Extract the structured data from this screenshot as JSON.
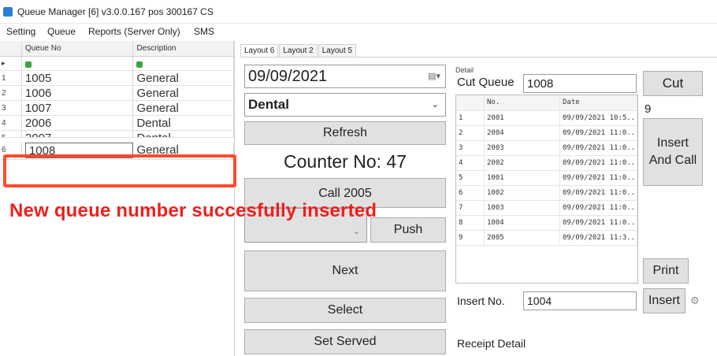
{
  "window": {
    "title": "Queue Manager [6] v3.0.0.167 pos 300167 CS"
  },
  "menu": [
    "Setting",
    "Queue",
    "Reports (Server Only)",
    "SMS"
  ],
  "grid": {
    "headers": [
      "Queue No",
      "Description"
    ],
    "rows": [
      {
        "num": "1",
        "queue": "1005",
        "desc": "General"
      },
      {
        "num": "2",
        "queue": "1006",
        "desc": "General"
      },
      {
        "num": "3",
        "queue": "1007",
        "desc": "General"
      },
      {
        "num": "4",
        "queue": "2006",
        "desc": "Dental"
      },
      {
        "num": "5",
        "queue": "2007",
        "desc": "Dental"
      },
      {
        "num": "6",
        "queue": "1008",
        "desc": "General"
      }
    ]
  },
  "tabs": [
    "Layout 6",
    "Layout 2",
    "Layout 5"
  ],
  "left_panel": {
    "date": "09/09/2021",
    "department": "Dental",
    "refresh": "Refresh",
    "counter": "Counter No: 47",
    "call": "Call 2005",
    "push": "Push",
    "next": "Next",
    "select": "Select",
    "set_served": "Set Served"
  },
  "detail": {
    "label": "Detail",
    "cut_queue_label": "Cut Queue",
    "cut_queue_value": "1008",
    "cut_button": "Cut",
    "count": "9",
    "insert_and_call": "Insert And Call",
    "print": "Print",
    "insert_no_label": "Insert No.",
    "insert_no_value": "1004",
    "insert_button": "Insert",
    "receipt_detail": "Receipt Detail",
    "columns": [
      "No.",
      "Date"
    ],
    "rows": [
      {
        "n": "1",
        "no": "2001",
        "date": "09/09/2021 10:5..."
      },
      {
        "n": "2",
        "no": "2004",
        "date": "09/09/2021 11:0..."
      },
      {
        "n": "3",
        "no": "2003",
        "date": "09/09/2021 11:0..."
      },
      {
        "n": "4",
        "no": "2002",
        "date": "09/09/2021 11:0..."
      },
      {
        "n": "5",
        "no": "1001",
        "date": "09/09/2021 11:0..."
      },
      {
        "n": "6",
        "no": "1002",
        "date": "09/09/2021 11:0..."
      },
      {
        "n": "7",
        "no": "1003",
        "date": "09/09/2021 11:0..."
      },
      {
        "n": "8",
        "no": "1004",
        "date": "09/09/2021 11:0..."
      },
      {
        "n": "9",
        "no": "2005",
        "date": "09/09/2021 11:3..."
      }
    ]
  },
  "notice": "New queue number succesfully inserted",
  "colors": {
    "highlight": "#ff4a2e",
    "notice": "#ee1f1f"
  }
}
